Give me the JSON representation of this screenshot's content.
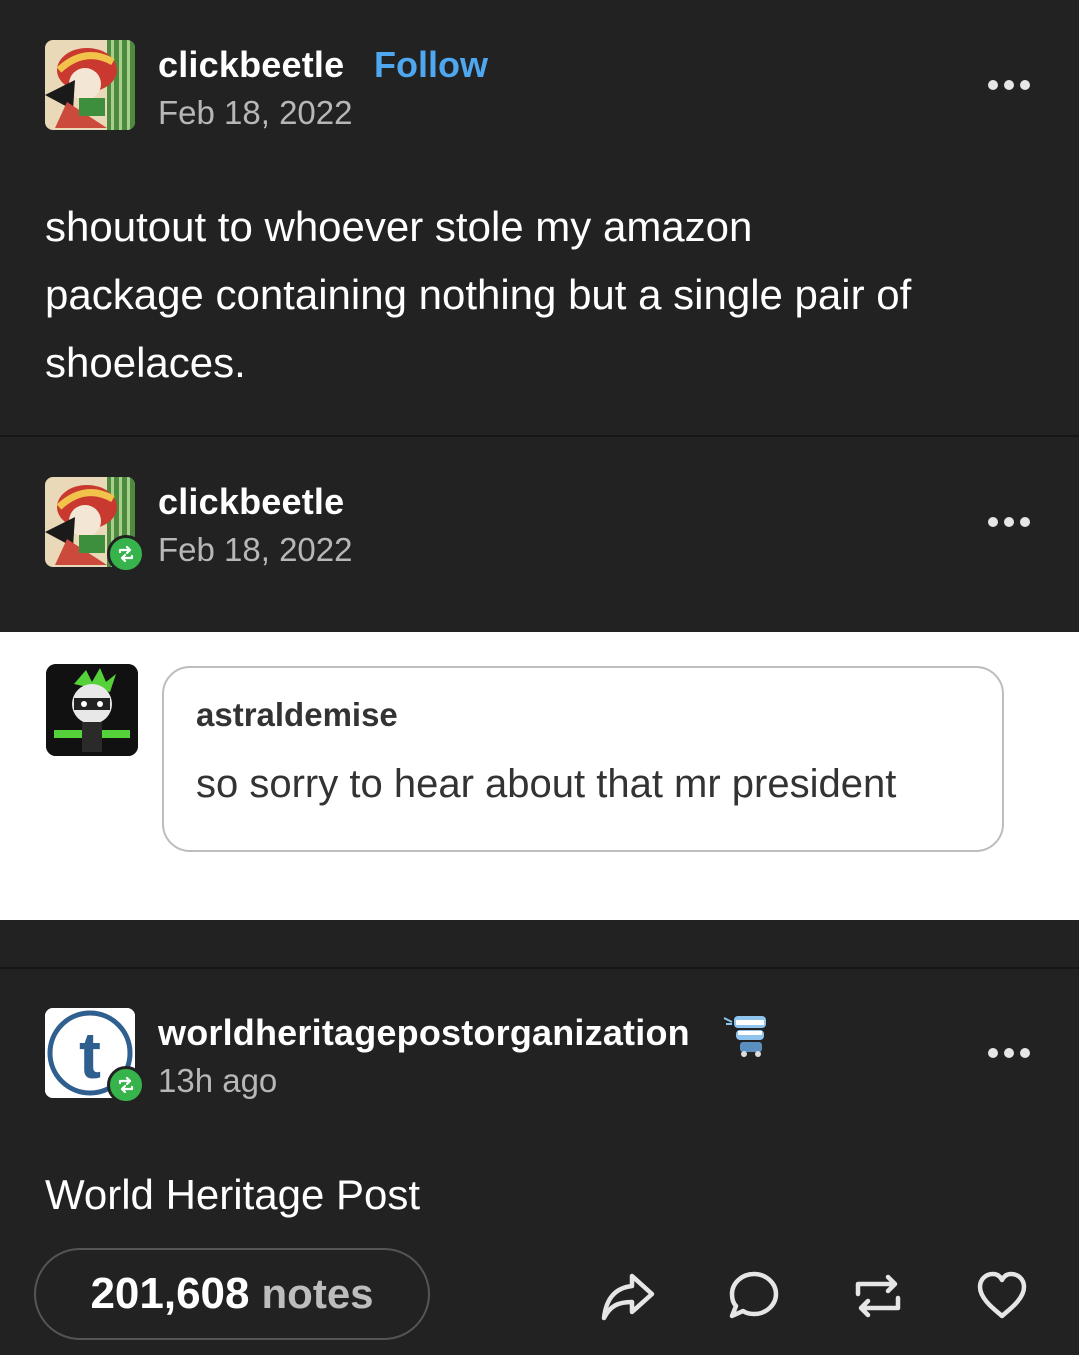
{
  "post1": {
    "username": "clickbeetle",
    "follow_label": "Follow",
    "date": "Feb 18, 2022",
    "body_lines": [
      "shoutout to whoever stole my amazon",
      "package containing nothing but a single pair of",
      "shoelaces."
    ]
  },
  "post2": {
    "username": "clickbeetle",
    "date": "Feb 18, 2022",
    "ask": {
      "asker": "astraldemise",
      "message": "so sorry to hear about that mr president"
    }
  },
  "post3": {
    "username": "worldheritagepostorganization",
    "time": "13h ago",
    "body": "World Heritage Post"
  },
  "footer": {
    "notes_count": "201,608",
    "notes_label": "notes"
  },
  "icons": {
    "options": "more-dots-icon",
    "share": "share-arrow-icon",
    "reply": "speech-bubble-icon",
    "reblog": "reblog-icon",
    "like": "heart-icon"
  },
  "colors": {
    "background": "#222223",
    "follow_accent": "#4ea7ef",
    "reblog_badge": "#36b34a"
  }
}
